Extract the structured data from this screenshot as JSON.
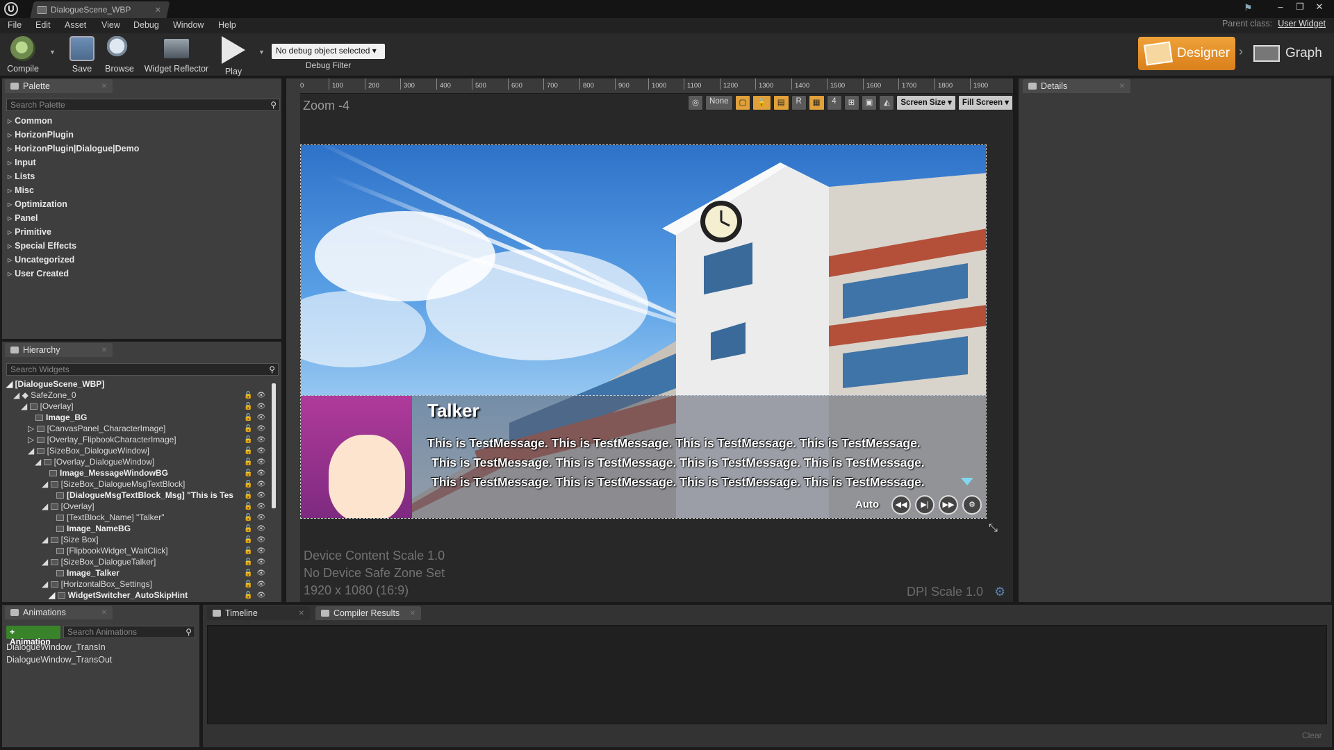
{
  "window": {
    "tab_title": "DialogueScene_WBP",
    "controls": [
      "‒",
      "❐",
      "✕"
    ]
  },
  "menu": [
    "File",
    "Edit",
    "Asset",
    "View",
    "Debug",
    "Window",
    "Help"
  ],
  "parent_class": {
    "label": "Parent class:",
    "value": "User Widget"
  },
  "toolbar": {
    "compile": "Compile",
    "save": "Save",
    "browse": "Browse",
    "widget_reflector": "Widget Reflector",
    "play": "Play",
    "debug_select": "No debug object selected ▾",
    "debug_filter": "Debug Filter",
    "designer": "Designer",
    "graph": "Graph"
  },
  "palette": {
    "tab": "Palette",
    "search_placeholder": "Search Palette",
    "categories": [
      "Common",
      "HorizonPlugin",
      "HorizonPlugin|Dialogue|Demo",
      "Input",
      "Lists",
      "Misc",
      "Optimization",
      "Panel",
      "Primitive",
      "Special Effects",
      "Uncategorized",
      "User Created"
    ]
  },
  "hierarchy": {
    "tab": "Hierarchy",
    "search_placeholder": "Search Widgets",
    "items": [
      "[DialogueScene_WBP]",
      "SafeZone_0",
      "[Overlay]",
      "Image_BG",
      "[CanvasPanel_CharacterImage]",
      "[Overlay_FlipbookCharacterImage]",
      "[SizeBox_DialogueWindow]",
      "[Overlay_DialogueWindow]",
      "Image_MessageWindowBG",
      "[SizeBox_DialogueMsgTextBlock]",
      "[DialogueMsgTextBlock_Msg] \"This is Tes",
      "[Overlay]",
      "[TextBlock_Name] \"Talker\"",
      "Image_NameBG",
      "[Size Box]",
      "[FlipbookWidget_WaitClick]",
      "[SizeBox_DialogueTalker]",
      "Image_Talker",
      "[HorizontalBox_Settings]",
      "WidgetSwitcher_AutoSkipHint"
    ]
  },
  "details": {
    "tab": "Details"
  },
  "canvas": {
    "zoom": "Zoom -4",
    "ruler_ticks": [
      "0",
      "100",
      "200",
      "300",
      "400",
      "500",
      "600",
      "700",
      "800",
      "900",
      "1000",
      "1100",
      "1200",
      "1300",
      "1400",
      "1500",
      "1600",
      "1700",
      "1800",
      "1900"
    ],
    "vp_none": "None",
    "vp_r": "R",
    "vp_grid": "4",
    "vp_screen_size": "Screen Size ▾",
    "vp_fill_screen": "Fill Screen ▾",
    "device_scale": "Device Content Scale 1.0",
    "safe_zone": "No Device Safe Zone Set",
    "resolution": "1920 x 1080 (16:9)",
    "dpi": "DPI Scale 1.0"
  },
  "dialogue": {
    "name": "Talker",
    "lines": [
      "This is TestMessage. This is TestMessage. This is TestMessage. This is TestMessage.",
      "This is TestMessage. This is TestMessage. This is TestMessage. This is TestMessage.",
      "This is TestMessage. This is TestMessage. This is TestMessage. This is TestMessage."
    ],
    "auto": "Auto",
    "controls": [
      "◀◀",
      "▶|",
      "▶▶",
      "⚙"
    ]
  },
  "animations": {
    "tab": "Animations",
    "add_button": "+ Animation",
    "search_placeholder": "Search Animations",
    "items": [
      "DialogueWindow_TransIn",
      "DialogueWindow_TransOut"
    ]
  },
  "bottom_tabs": {
    "timeline": "Timeline",
    "compiler": "Compiler Results",
    "clear": "Clear"
  },
  "colors": {
    "accent": "#E8922A",
    "panel": "#3E3E3E",
    "background": "#1A1A1A"
  }
}
